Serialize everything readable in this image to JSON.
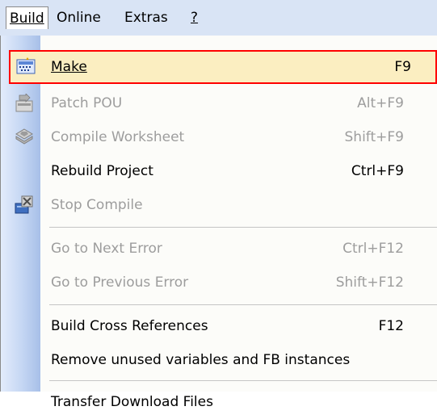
{
  "menubar": {
    "items": [
      {
        "label": "Build",
        "active": true
      },
      {
        "label": "Online",
        "active": false
      },
      {
        "label": "Extras",
        "active": false
      },
      {
        "label": "?",
        "active": false
      }
    ]
  },
  "menu": {
    "items": [
      {
        "label": "Make",
        "shortcut": "F9",
        "state": "highlighted",
        "icon": "make-icon"
      },
      {
        "label": "Patch POU",
        "shortcut": "Alt+F9",
        "state": "disabled",
        "icon": "patch-pou-icon"
      },
      {
        "label": "Compile Worksheet",
        "shortcut": "Shift+F9",
        "state": "disabled",
        "icon": "compile-worksheet-icon"
      },
      {
        "label": "Rebuild Project",
        "shortcut": "Ctrl+F9",
        "state": "enabled",
        "icon": ""
      },
      {
        "label": "Stop Compile",
        "shortcut": "",
        "state": "disabled",
        "icon": "stop-compile-icon"
      },
      {
        "label": "Go to Next Error",
        "shortcut": "Ctrl+F12",
        "state": "disabled",
        "icon": ""
      },
      {
        "label": "Go to Previous Error",
        "shortcut": "Shift+F12",
        "state": "disabled",
        "icon": ""
      },
      {
        "label": "Build Cross References",
        "shortcut": "F12",
        "state": "enabled",
        "icon": ""
      },
      {
        "label": "Remove unused variables and FB instances",
        "shortcut": "",
        "state": "enabled",
        "icon": ""
      },
      {
        "label": "Transfer Download Files",
        "shortcut": "",
        "state": "enabled",
        "icon": ""
      }
    ]
  },
  "colors": {
    "highlight_bg": "#fbeec1",
    "highlight_border": "#ff0000",
    "disabled_text": "#9d9d9d",
    "menubar_bg": "#d9e4f5"
  }
}
